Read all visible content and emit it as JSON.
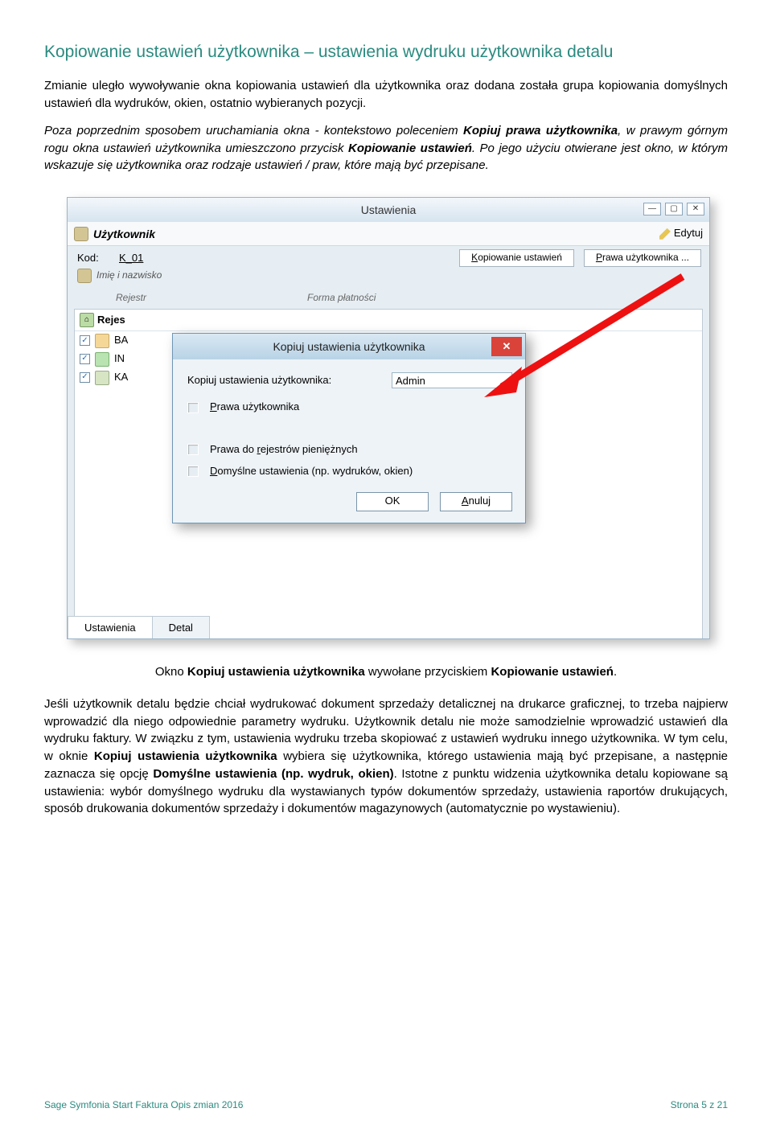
{
  "heading": "Kopiowanie ustawień użytkownika – ustawienia wydruku użytkownika detalu",
  "p1_a": "Zmianie uległo wywoływanie okna kopiowania ustawień dla użytkownika oraz dodana została grupa kopiowania domyślnych ustawień dla wydruków, okien, ostatnio wybieranych pozycji.",
  "p2_a": "Poza poprzednim sposobem uruchamiania okna - kontekstowo poleceniem ",
  "p2_b": "Kopiuj prawa użytkownika",
  "p2_c": ", w prawym górnym rogu okna ustawień użytkownika umieszczono przycisk ",
  "p2_d": "Kopiowanie ustawień",
  "p2_e": ". Po jego użyciu otwierane jest okno, w którym wskazuje się użytkownika oraz rodzaje ustawień / praw, które mają być przepisane.",
  "win": {
    "title": "Ustawienia",
    "userLabel": "Użytkownik",
    "edit": "Edytuj",
    "kodLabel": "Kod:",
    "kodValue": "K_01",
    "btnCopy": "opiowanie ustawień",
    "btnCopyU": "K",
    "btnRights": "rawa użytkownika ...",
    "btnRightsU": "P",
    "imie": "Imię i nazwisko",
    "col1": "Rejestr",
    "col2": "Forma płatności",
    "rejLabel": "Rejes",
    "row1": "BA",
    "row2": "IN",
    "row3": "KA",
    "tab1": "Ustawienia",
    "tab2": "Detal"
  },
  "dialog": {
    "title": "Kopiuj ustawienia użytkownika",
    "fromLabel": "Kopiuj ustawienia użytkownika:",
    "fromValue": "Admin",
    "opt1a": "P",
    "opt1b": "rawa użytkownika",
    "opt2a": "Prawa do ",
    "opt2u": "r",
    "opt2b": "ejestrów pieniężnych",
    "opt3u": "D",
    "opt3b": "omyślne ustawienia (np. wydruków, okien)",
    "ok": "OK",
    "cancelU": "A",
    "cancel": "nuluj"
  },
  "caption_a": "Okno ",
  "caption_b": "Kopiuj ustawienia użytkownika",
  "caption_c": " wywołane przyciskiem ",
  "caption_d": "Kopiowanie ustawień",
  "caption_e": ".",
  "p3_a": "Jeśli użytkownik detalu będzie chciał wydrukować dokument sprzedaży detalicznej na drukarce graficznej, to trzeba najpierw wprowadzić dla niego odpowiednie parametry wydruku. Użytkownik detalu nie może samodzielnie wprowadzić ustawień dla wydruku faktury. W związku z tym, ustawienia wydruku trzeba skopiować z ustawień wydruku innego użytkownika. W tym celu, w oknie ",
  "p3_b": "Kopiuj ustawienia użytkownika",
  "p3_c": " wybiera się użytkownika, którego ustawienia mają być przepisane, a następnie zaznacza się opcję ",
  "p3_d": "Domyślne ustawienia (np. wydruk, okien)",
  "p3_e": ". Istotne z punktu widzenia użytkownika detalu kopiowane są ustawienia: wybór domyślnego wydruku dla wystawianych typów dokumentów sprzedaży, ustawienia raportów drukujących, sposób drukowania dokumentów sprzedaży i dokumentów magazynowych (automatycznie po wystawieniu).",
  "footer_left": "Sage Symfonia Start Faktura Opis zmian 2016",
  "footer_right": "Strona 5 z 21"
}
